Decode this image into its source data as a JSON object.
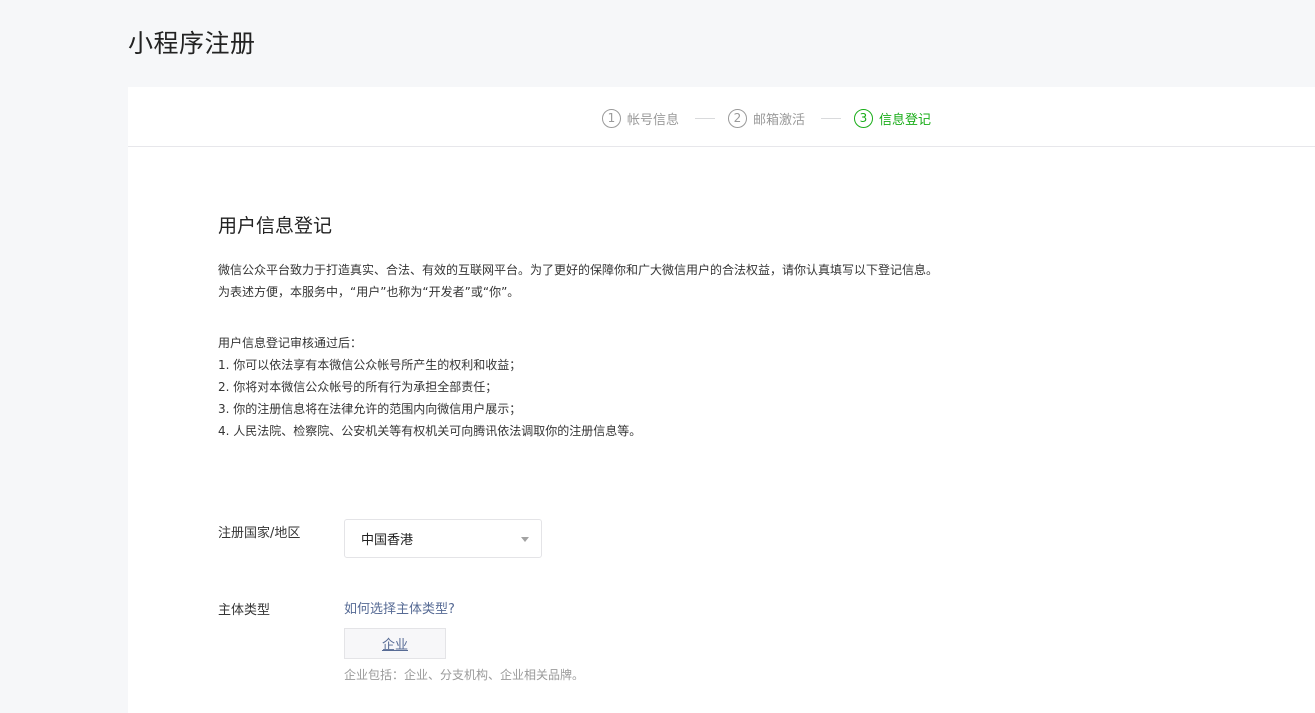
{
  "page": {
    "title": "小程序注册"
  },
  "steps": [
    {
      "number": "1",
      "label": "帐号信息",
      "state": "done"
    },
    {
      "number": "2",
      "label": "邮箱激活",
      "state": "done"
    },
    {
      "number": "3",
      "label": "信息登记",
      "state": "active"
    }
  ],
  "colors": {
    "active_step": "#1aad19",
    "link": "#576b95",
    "muted_text": "#9a9a9a"
  },
  "section": {
    "title": "用户信息登记",
    "intro_lines": [
      "微信公众平台致力于打造真实、合法、有效的互联网平台。为了更好的保障你和广大微信用户的合法权益，请你认真填写以下登记信息。",
      "为表述方便，本服务中，“用户”也称为“开发者”或“你”。"
    ],
    "rules_heading": "用户信息登记审核通过后：",
    "rules": [
      "1. 你可以依法享有本微信公众帐号所产生的权利和收益；",
      "2. 你将对本微信公众帐号的所有行为承担全部责任；",
      "3. 你的注册信息将在法律允许的范围内向微信用户展示；",
      "4. 人民法院、检察院、公安机关等有权机关可向腾讯依法调取你的注册信息等。"
    ]
  },
  "form": {
    "region": {
      "label": "注册国家/地区",
      "selected": "中国香港",
      "icon": "chevron-down-icon"
    },
    "entity_type": {
      "label": "主体类型",
      "help_link": "如何选择主体类型?",
      "option": "企业",
      "option_description": "企业包括：企业、分支机构、企业相关品牌。"
    }
  }
}
